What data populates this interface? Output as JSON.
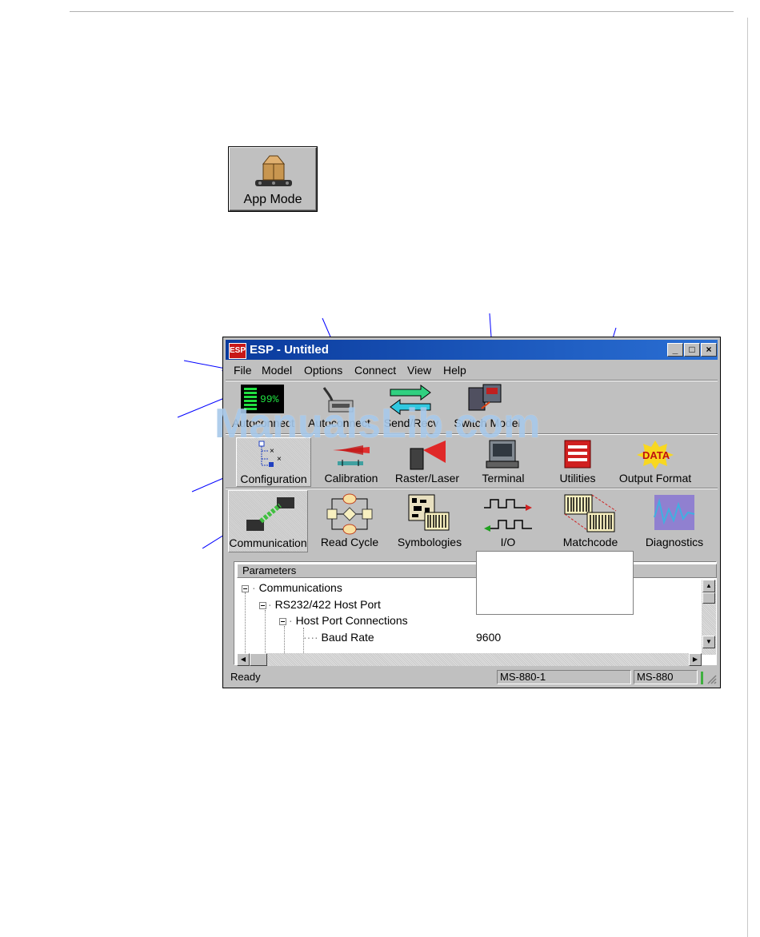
{
  "app_mode_button": {
    "label": "App Mode"
  },
  "window": {
    "icon_text": "ESP",
    "title": "ESP - Untitled",
    "controls": {
      "minimize": "_",
      "maximize": "□",
      "close": "×"
    }
  },
  "menubar": {
    "items": [
      "File",
      "Model",
      "Options",
      "Connect",
      "View",
      "Help"
    ]
  },
  "toolbar1": {
    "items": [
      {
        "label": "Autoconnect",
        "icon": "monitor-99-percent-icon",
        "icon_text": "99%"
      },
      {
        "label": "Autoconnect",
        "icon": "cable-connector-icon"
      },
      {
        "label": "Send/Recv",
        "icon": "send-receive-arrows-icon"
      },
      {
        "label": "Switch Model",
        "icon": "switch-model-icon"
      }
    ]
  },
  "toolbar2": {
    "items": [
      {
        "label": "Configuration",
        "icon": "tree-config-icon",
        "active": true
      },
      {
        "label": "Calibration",
        "icon": "calibration-icon"
      },
      {
        "label": "Raster/Laser",
        "icon": "raster-laser-icon"
      },
      {
        "label": "Terminal",
        "icon": "terminal-icon"
      },
      {
        "label": "Utilities",
        "icon": "utilities-icon"
      },
      {
        "label": "Output Format",
        "icon": "data-output-icon",
        "icon_text": "DATA"
      }
    ]
  },
  "toolbar3": {
    "items": [
      {
        "label": "Communication",
        "icon": "communication-icon",
        "active": true
      },
      {
        "label": "Read Cycle",
        "icon": "read-cycle-flow-icon"
      },
      {
        "label": "Symbologies",
        "icon": "symbologies-icon"
      },
      {
        "label": "I/O",
        "icon": "io-pulse-icon"
      },
      {
        "label": "Matchcode",
        "icon": "matchcode-barcode-icon"
      },
      {
        "label": "Diagnostics",
        "icon": "diagnostics-wave-icon"
      }
    ]
  },
  "parameters": {
    "header": "Parameters",
    "rows": [
      {
        "label": "Communications",
        "value": ""
      },
      {
        "label": "RS232/422 Host Port",
        "value": ""
      },
      {
        "label": "Host Port Connections",
        "value": ""
      },
      {
        "label": "Baud Rate",
        "value": "9600"
      }
    ]
  },
  "statusbar": {
    "status": "Ready",
    "model_instance": "MS-880-1",
    "model": "MS-880"
  },
  "watermark": "ManualsLib.com",
  "colors": {
    "titlebar": "#0a3a9c",
    "callout": "#0000ff",
    "chrome": "#c0c0c0"
  }
}
